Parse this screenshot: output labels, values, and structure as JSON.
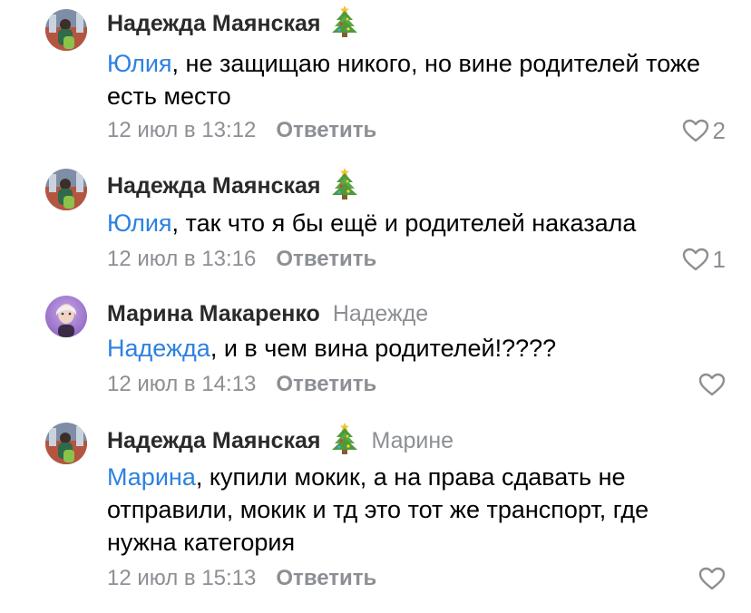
{
  "colors": {
    "link": "#2d81e0",
    "secondary": "#8c8f94",
    "author": "#2a2a2a",
    "text": "#000000"
  },
  "comments": [
    {
      "author": "Надежда Маянская",
      "badge_icon": "christmas-tree-icon",
      "reply_to": "",
      "mention": "Юлия",
      "text": ", не защищаю никого, но вине родителей тоже есть место",
      "date": "12 июл в 13:12",
      "reply_label": "Ответить",
      "likes": "2"
    },
    {
      "author": "Надежда Маянская",
      "badge_icon": "christmas-tree-icon",
      "reply_to": "",
      "mention": "Юлия",
      "text": ", так что я бы ещё и родителей наказала",
      "date": "12 июл в 13:16",
      "reply_label": "Ответить",
      "likes": "1"
    },
    {
      "author": "Марина Макаренко",
      "badge_icon": "",
      "reply_to": "Надежде",
      "mention": "Надежда",
      "text": ", и в чем вина родителей!????",
      "date": "12 июл в 14:13",
      "reply_label": "Ответить",
      "likes": ""
    },
    {
      "author": "Надежда Маянская",
      "badge_icon": "christmas-tree-icon",
      "reply_to": "Марине",
      "mention": "Марина",
      "text": ", купили мокик, а на права сдавать не отправили, мокик и тд это тот же транспорт, где нужна категория",
      "date": "12 июл в 15:13",
      "reply_label": "Ответить",
      "likes": ""
    }
  ]
}
